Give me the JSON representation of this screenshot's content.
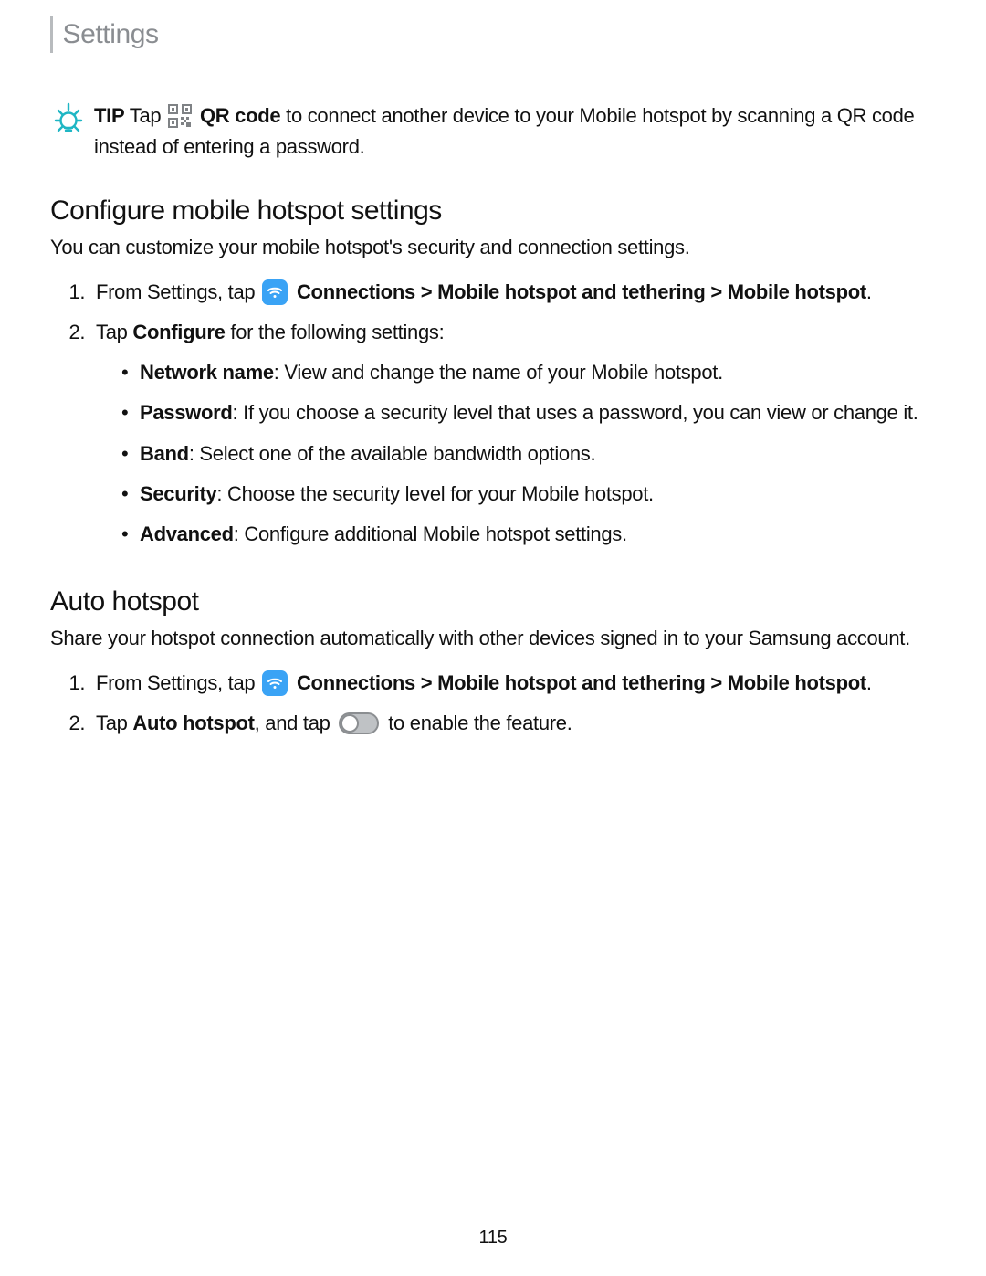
{
  "header": {
    "title": "Settings"
  },
  "tip": {
    "label": "TIP",
    "pre": "  Tap",
    "qr_bold": " QR code",
    "rest": " to connect another device to your Mobile hotspot by scanning a QR code instead of entering a password."
  },
  "section1": {
    "title": "Configure mobile hotspot settings",
    "intro": "You can customize your mobile hotspot's security and connection settings.",
    "step1": {
      "lead": "From Settings, tap ",
      "path": " Connections > Mobile hotspot and tethering > Mobile hotspot",
      "end": "."
    },
    "step2": {
      "lead": "Tap ",
      "bold": "Configure",
      "rest": " for the following settings:"
    },
    "bullets": {
      "b1": {
        "term": "Network name",
        "desc": ": View and change the name of your Mobile hotspot."
      },
      "b2": {
        "term": "Password",
        "desc": ": If you choose a security level that uses a password, you can view or change it."
      },
      "b3": {
        "term": "Band",
        "desc": ": Select one of the available bandwidth options."
      },
      "b4": {
        "term": "Security",
        "desc": ": Choose the security level for your Mobile hotspot."
      },
      "b5": {
        "term": "Advanced",
        "desc": ": Configure additional Mobile hotspot settings."
      }
    }
  },
  "section2": {
    "title": "Auto hotspot",
    "intro": "Share your hotspot connection automatically with other devices signed in to your Samsung account.",
    "step1": {
      "lead": "From Settings, tap ",
      "path": " Connections > Mobile hotspot and tethering > Mobile hotspot",
      "end": "."
    },
    "step2": {
      "lead": "Tap ",
      "bold": "Auto hotspot",
      "mid": ", and tap ",
      "rest": " to enable the feature."
    }
  },
  "page_number": "115"
}
